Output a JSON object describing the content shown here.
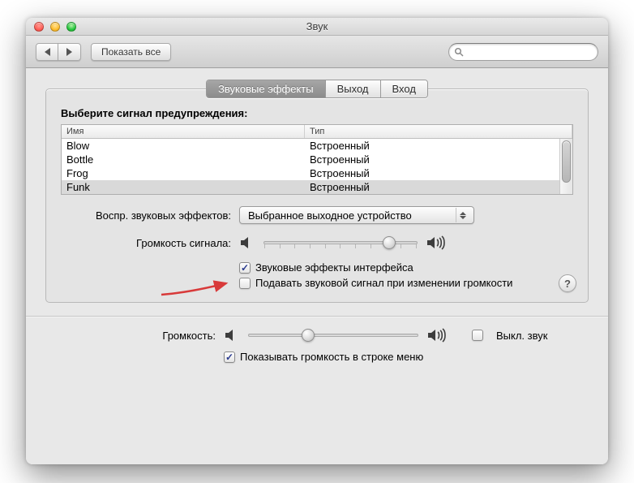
{
  "window": {
    "title": "Звук"
  },
  "toolbar": {
    "show_all": "Показать все",
    "search_placeholder": ""
  },
  "tabs": [
    {
      "label": "Звуковые эффекты",
      "active": true
    },
    {
      "label": "Выход",
      "active": false
    },
    {
      "label": "Вход",
      "active": false
    }
  ],
  "alerts": {
    "prompt": "Выберите сигнал предупреждения:",
    "columns": {
      "name": "Имя",
      "type": "Тип"
    },
    "rows": [
      {
        "name": "Blow",
        "type": "Встроенный",
        "selected": false
      },
      {
        "name": "Bottle",
        "type": "Встроенный",
        "selected": false
      },
      {
        "name": "Frog",
        "type": "Встроенный",
        "selected": false
      },
      {
        "name": "Funk",
        "type": "Встроенный",
        "selected": true
      }
    ]
  },
  "playthrough": {
    "label": "Воспр. звуковых эффектов:",
    "value": "Выбранное выходное устройство"
  },
  "alert_volume": {
    "label": "Громкость сигнала:",
    "value": 0.82
  },
  "checks": {
    "ui_sounds": {
      "label": "Звуковые эффекты интерфейса",
      "checked": true
    },
    "feedback": {
      "label": "Подавать звуковой сигнал при изменении громкости",
      "checked": false
    }
  },
  "output": {
    "label": "Громкость:",
    "value": 0.35,
    "mute": {
      "label": "Выкл. звук",
      "checked": false
    },
    "menubar": {
      "label": "Показывать громкость в строке меню",
      "checked": true
    }
  },
  "help": "?"
}
